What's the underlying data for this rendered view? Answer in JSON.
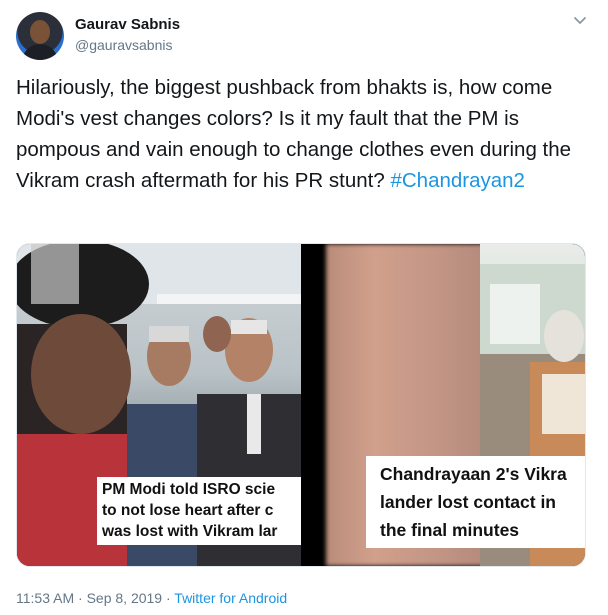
{
  "author": {
    "name": "Gaurav Sabnis",
    "handle": "@gauravsabnis"
  },
  "tweet": {
    "text": "Hilariously, the biggest pushback from bhakts is, how come Modi's vest changes colors? Is it my fault that the PM is pompous and vain enough to change clothes even during the Vikram crash aftermath for his PR stunt?",
    "hashtag": "#Chandrayan2"
  },
  "media": {
    "left_caption": [
      "PM Modi told ISRO scie",
      "to not lose heart after c",
      "was lost with Vikram lar"
    ],
    "right_caption": [
      "Chandrayaan 2's Vikra",
      "lander lost contact in",
      "the final minutes"
    ]
  },
  "footer": {
    "time": "11:53 AM",
    "date": "Sep 8, 2019",
    "separator": "·",
    "source": "Twitter for Android"
  },
  "colors": {
    "link": "#1b95e0",
    "secondary_text": "#657786",
    "primary_text": "#14171a"
  },
  "icons": [
    "avatar",
    "chevron-down-icon"
  ]
}
